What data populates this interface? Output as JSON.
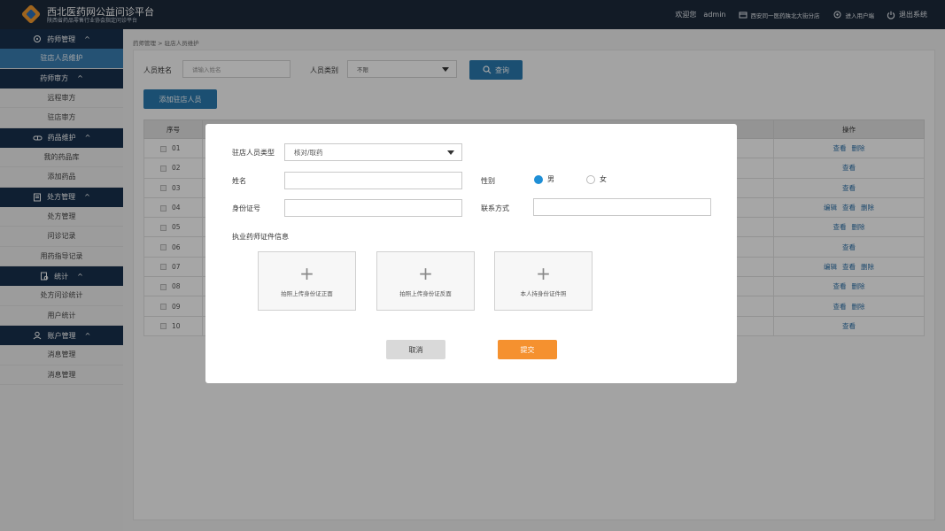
{
  "header": {
    "title": "西北医药网公益问诊平台",
    "subtitle": "陕西省药品零售行业协会指定问诊平台",
    "welcome": "欢迎您",
    "username": "admin",
    "store": "西安同一医药陕北大街分店",
    "user_center": "进入用户端",
    "logout": "退出系统"
  },
  "sidebar": {
    "groups": [
      {
        "label": "药师管理",
        "icon": "pharmacist-icon",
        "items": [
          "驻店人员维护"
        ]
      },
      {
        "label": "药师审方",
        "icon": "",
        "items": [
          "远程审方",
          "驻店审方"
        ]
      },
      {
        "label": "药品维护",
        "icon": "pill-icon",
        "items": [
          "我的药品库",
          "添加药品"
        ]
      },
      {
        "label": "处方管理",
        "icon": "prescription-icon",
        "items": [
          "处方管理",
          "问诊记录",
          "用药指导记录"
        ]
      },
      {
        "label": "统计",
        "icon": "stats-icon",
        "items": [
          "处方问诊统计",
          "用户统计"
        ]
      },
      {
        "label": "账户管理",
        "icon": "account-icon",
        "items": [
          "消息管理",
          "消息管理"
        ]
      }
    ],
    "active_item": "驻店人员维护"
  },
  "breadcrumb": "药师管理 > 驻店人员维护",
  "filter": {
    "name_label": "人员姓名",
    "name_placeholder": "请输入姓名",
    "type_label": "人员类别",
    "type_value": "不限",
    "search_label": "查询"
  },
  "add_button": "添加驻店人员",
  "table": {
    "headers": [
      "序号",
      "操作"
    ],
    "rows": [
      {
        "idx": "01",
        "ops": [
          "查看",
          "删除"
        ]
      },
      {
        "idx": "02",
        "ops": [
          "查看"
        ]
      },
      {
        "idx": "03",
        "ops": [
          "查看"
        ]
      },
      {
        "idx": "04",
        "ops": [
          "编辑",
          "查看",
          "删除"
        ]
      },
      {
        "idx": "05",
        "ops": [
          "查看",
          "删除"
        ]
      },
      {
        "idx": "06",
        "ops": [
          "查看"
        ]
      },
      {
        "idx": "07",
        "ops": [
          "编辑",
          "查看",
          "删除"
        ]
      },
      {
        "idx": "08",
        "ops": [
          "查看",
          "删除"
        ]
      },
      {
        "idx": "09",
        "ops": [
          "查看",
          "删除"
        ]
      },
      {
        "idx": "10",
        "ops": [
          "查看"
        ]
      }
    ]
  },
  "modal": {
    "type_label": "驻店人员类型",
    "type_value": "核对/取药",
    "name_label": "姓名",
    "name_value": "",
    "gender_label": "性别",
    "gender_options": [
      "男",
      "女"
    ],
    "gender_selected": "男",
    "id_label": "身份证号",
    "id_value": "",
    "contact_label": "联系方式",
    "contact_value": "",
    "cert_section": "执业药师证件信息",
    "uploads": [
      "拍照上传身份证正面",
      "拍照上传身份证反面",
      "本人持身份证件照"
    ],
    "cancel": "取消",
    "submit": "提交"
  },
  "colors": {
    "header_bg": "#1d2a3b",
    "nav_group_bg": "#17304d",
    "active_item": "#3a7eb3",
    "primary": "#2a7ab0",
    "link": "#2a6fa8",
    "submit": "#f5912f",
    "radio_on": "#1f8fd6"
  }
}
